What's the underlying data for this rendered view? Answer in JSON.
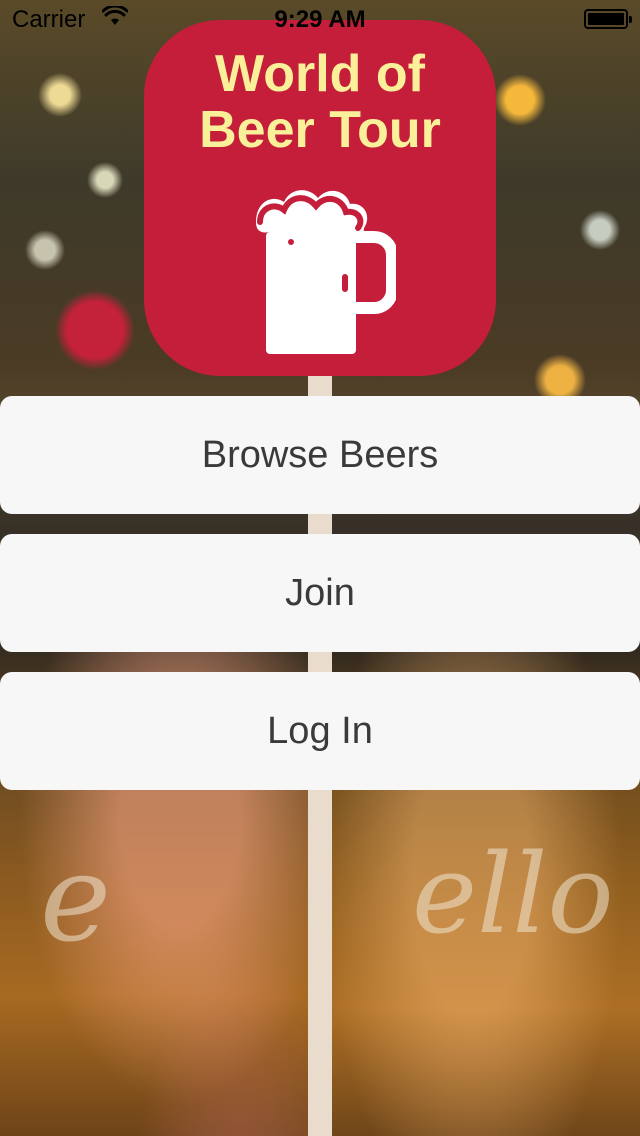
{
  "status_bar": {
    "carrier": "Carrier",
    "time": "9:29 AM"
  },
  "logo": {
    "title_line1": "World of",
    "title_line2": "Beer Tour",
    "icon": "beer-mug-icon",
    "background_color": "#c41e3a",
    "text_color": "#fbf09a"
  },
  "buttons": {
    "browse": "Browse Beers",
    "join": "Join",
    "login": "Log In"
  }
}
